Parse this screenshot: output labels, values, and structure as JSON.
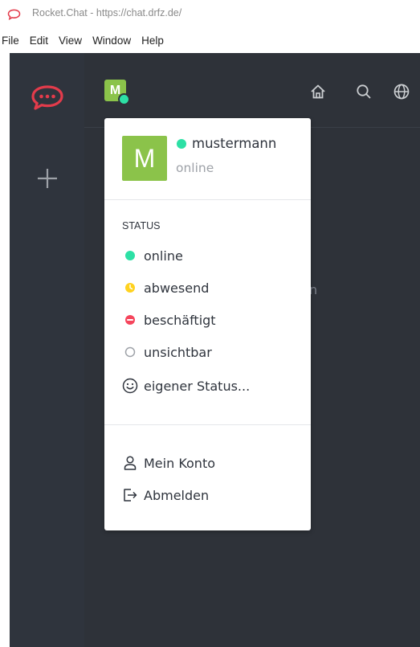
{
  "window": {
    "title": "Rocket.Chat - https://chat.drfz.de/"
  },
  "menu": [
    "File",
    "Edit",
    "View",
    "Window",
    "Help"
  ],
  "colors": {
    "rail_bg": "#2f343d",
    "sidebar_bg": "#2e3239",
    "avatar_green": "#8bc34a",
    "online": "#2de0a5",
    "away": "#ffd21f",
    "busy": "#f5455c",
    "brand_red": "#e33b4b"
  },
  "header": {
    "avatar_initial": "M",
    "icons": [
      "home-icon",
      "search-icon",
      "globe-icon"
    ]
  },
  "background_text": "n",
  "popover": {
    "avatar_initial": "M",
    "username": "mustermann",
    "status": "online",
    "status_section_title": "STATUS",
    "statuses": [
      {
        "label": "online",
        "icon": "online-dot"
      },
      {
        "label": "abwesend",
        "icon": "away-clock"
      },
      {
        "label": "beschäftigt",
        "icon": "busy-minus"
      },
      {
        "label": "unsichtbar",
        "icon": "invisible-circle"
      },
      {
        "label": "eigener Status...",
        "icon": "smiley-icon"
      }
    ],
    "account": [
      {
        "label": "Mein Konto",
        "icon": "user-icon"
      },
      {
        "label": "Abmelden",
        "icon": "logout-icon"
      }
    ]
  }
}
